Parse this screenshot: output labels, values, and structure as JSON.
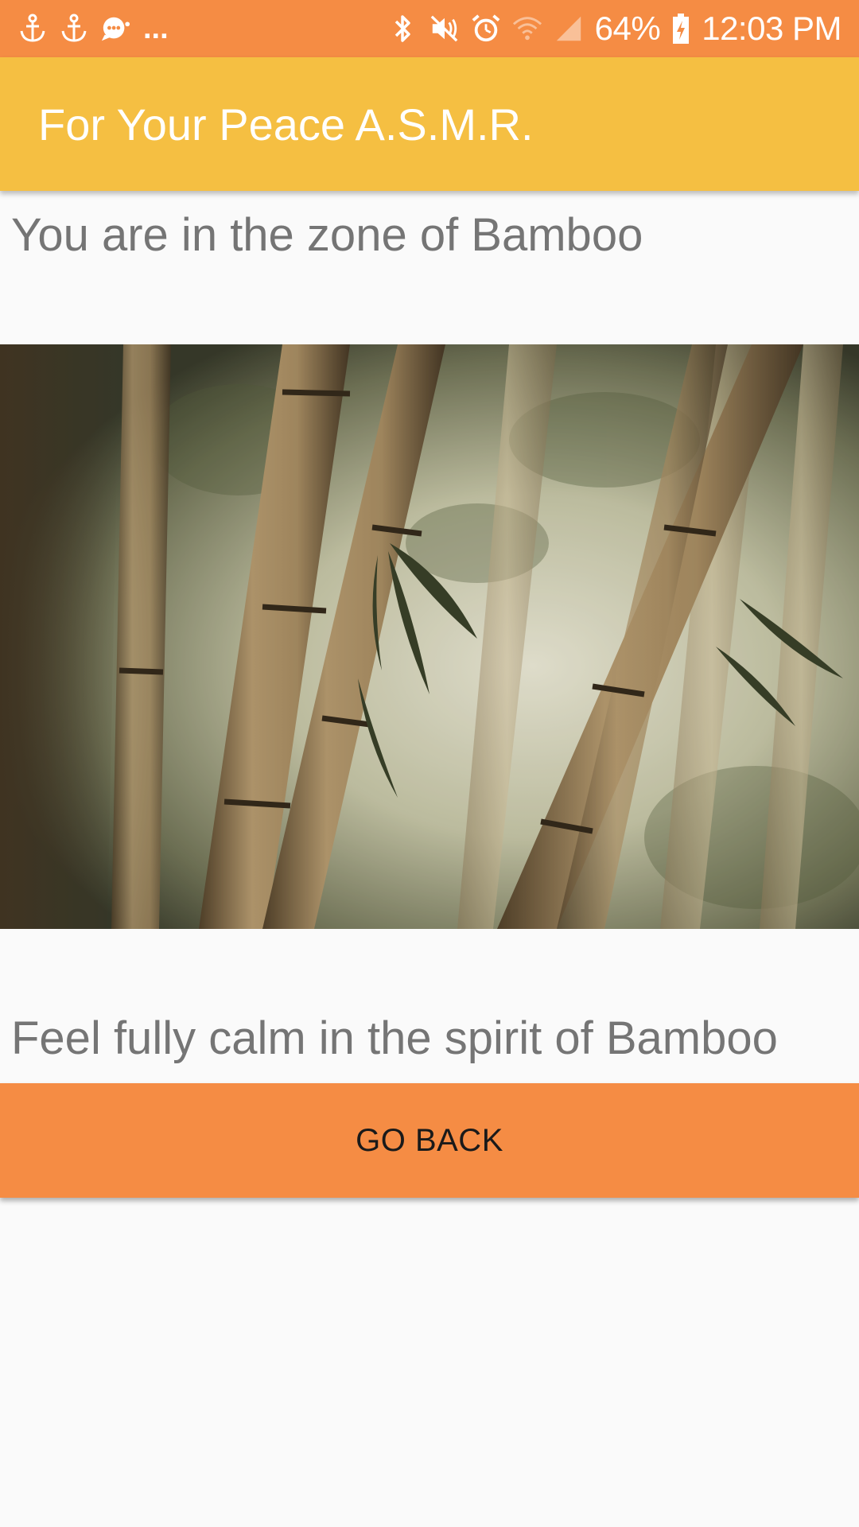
{
  "status_bar": {
    "left_icons": [
      "anchor-icon",
      "anchor-icon",
      "chat-notification-icon"
    ],
    "overflow": "...",
    "right_icons": [
      "bluetooth-icon",
      "mute-icon",
      "alarm-icon",
      "wifi-icon",
      "signal-icon"
    ],
    "battery": "64%",
    "time": "12:03 PM"
  },
  "app_bar": {
    "title": "For Your Peace A.S.M.R."
  },
  "main": {
    "zone_text": "You are in the zone of Bamboo",
    "image": "bamboo-forest-image",
    "calm_text": "Feel fully calm in the spirit of Bamboo",
    "go_back_label": "GO BACK"
  },
  "colors": {
    "status_bar": "#f58c44",
    "app_bar": "#f5bf42",
    "button": "#f58c44",
    "body_text": "#757575"
  }
}
